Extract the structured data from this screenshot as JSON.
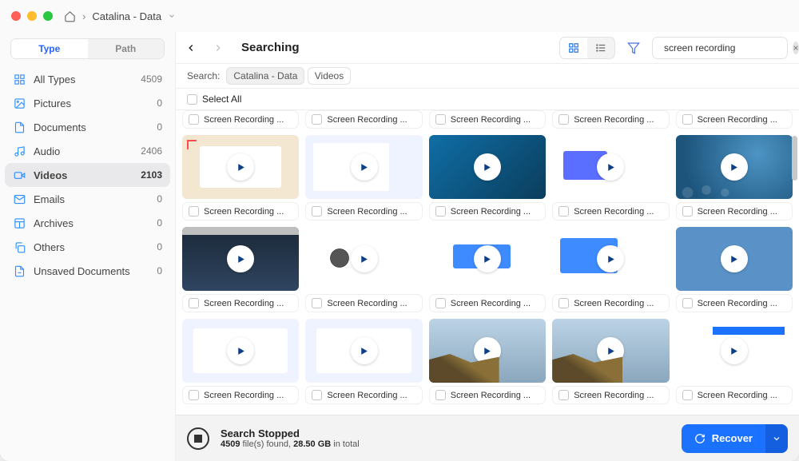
{
  "breadcrumb": {
    "home_icon": "home",
    "volume": "Catalina - Data"
  },
  "sidebar": {
    "segments": {
      "type": "Type",
      "path": "Path"
    },
    "active_segment": "type",
    "categories": [
      {
        "id": "all",
        "icon": "grid",
        "label": "All Types",
        "count": "4509"
      },
      {
        "id": "pictures",
        "icon": "image",
        "label": "Pictures",
        "count": "0"
      },
      {
        "id": "docs",
        "icon": "doc",
        "label": "Documents",
        "count": "0"
      },
      {
        "id": "audio",
        "icon": "music",
        "label": "Audio",
        "count": "2406"
      },
      {
        "id": "videos",
        "icon": "video",
        "label": "Videos",
        "count": "2103"
      },
      {
        "id": "emails",
        "icon": "mail",
        "label": "Emails",
        "count": "0"
      },
      {
        "id": "archives",
        "icon": "archive",
        "label": "Archives",
        "count": "0"
      },
      {
        "id": "others",
        "icon": "copy",
        "label": "Others",
        "count": "0"
      },
      {
        "id": "unsaved",
        "icon": "docx",
        "label": "Unsaved Documents",
        "count": "0"
      }
    ],
    "selected_category": "videos"
  },
  "toolbar": {
    "title": "Searching",
    "view_active": "grid",
    "search_value": "screen recording"
  },
  "filters": {
    "label": "Search:",
    "chips": [
      {
        "label": "Catalina - Data",
        "active": true
      },
      {
        "label": "Videos",
        "active": false
      }
    ]
  },
  "select_all_label": "Select All",
  "item_label": "Screen Recording ...",
  "rows": [
    {
      "caponly": true,
      "thumbs": [
        "",
        "",
        "",
        "",
        ""
      ]
    },
    {
      "caponly": false,
      "thumbs": [
        "th-a",
        "th-b",
        "th-c",
        "th-d",
        "th-e"
      ]
    },
    {
      "caponly": false,
      "thumbs": [
        "th-f",
        "th-g",
        "th-h",
        "th-i",
        "th-j"
      ]
    },
    {
      "caponly": false,
      "thumbs": [
        "th-k",
        "th-k",
        "th-l",
        "th-l",
        "th-m"
      ]
    }
  ],
  "footer": {
    "heading": "Search Stopped",
    "count": "4509",
    "files_word": "file(s) found,",
    "size": "28.50 GB",
    "total_word": "in total",
    "recover_label": "Recover"
  }
}
